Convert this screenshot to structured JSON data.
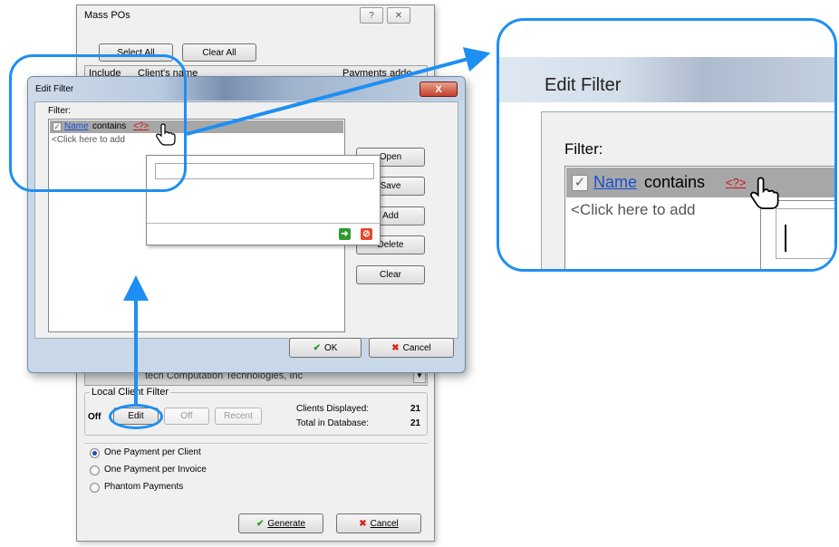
{
  "mass_pos": {
    "title": "Mass POs",
    "help_glyph": "?",
    "close_glyph": "✕",
    "select_all": "Select All",
    "clear_all": "Clear All",
    "col_include": "Include",
    "col_client_name": "Client's name",
    "col_payments": "Payments adde",
    "last_row_text": "tech Computation Technologies, Inc",
    "local_filter_label": "Local Client Filter",
    "filter_state": "Off",
    "edit_label": "Edit",
    "off_label": "Off",
    "recent_label": "Recent",
    "clients_displayed_label": "Clients Displayed:",
    "clients_displayed_value": "21",
    "total_label": "Total in Database:",
    "total_value": "21",
    "radio_options": [
      {
        "label": "One Payment per Client",
        "selected": true
      },
      {
        "label": "One Payment per Invoice",
        "selected": false
      },
      {
        "label": "Phantom Payments",
        "selected": false
      }
    ],
    "generate_label": "Generate",
    "cancel_label": "Cancel"
  },
  "edit_filter": {
    "title": "Edit Filter",
    "close_glyph": "X",
    "filter_label": "Filter:",
    "condition_field": "Name",
    "condition_op": "contains",
    "condition_value": "<?>",
    "add_row_hint": "<Click here to add",
    "buttons": {
      "open": "Open",
      "save": "Save",
      "add": "Add",
      "delete": "Delete",
      "clear": "Clear"
    },
    "ok_label": "OK",
    "cancel_label": "Cancel",
    "popup_value": ""
  },
  "zoom": {
    "title": "Edit Filter",
    "filter_label": "Filter:",
    "condition_field": "Name",
    "condition_op": "contains",
    "condition_value": "<?>",
    "add_row_hint": "<Click here to add"
  },
  "colors": {
    "callout": "#1e8ff2",
    "link": "#1a4fd0",
    "value": "#d01010"
  }
}
